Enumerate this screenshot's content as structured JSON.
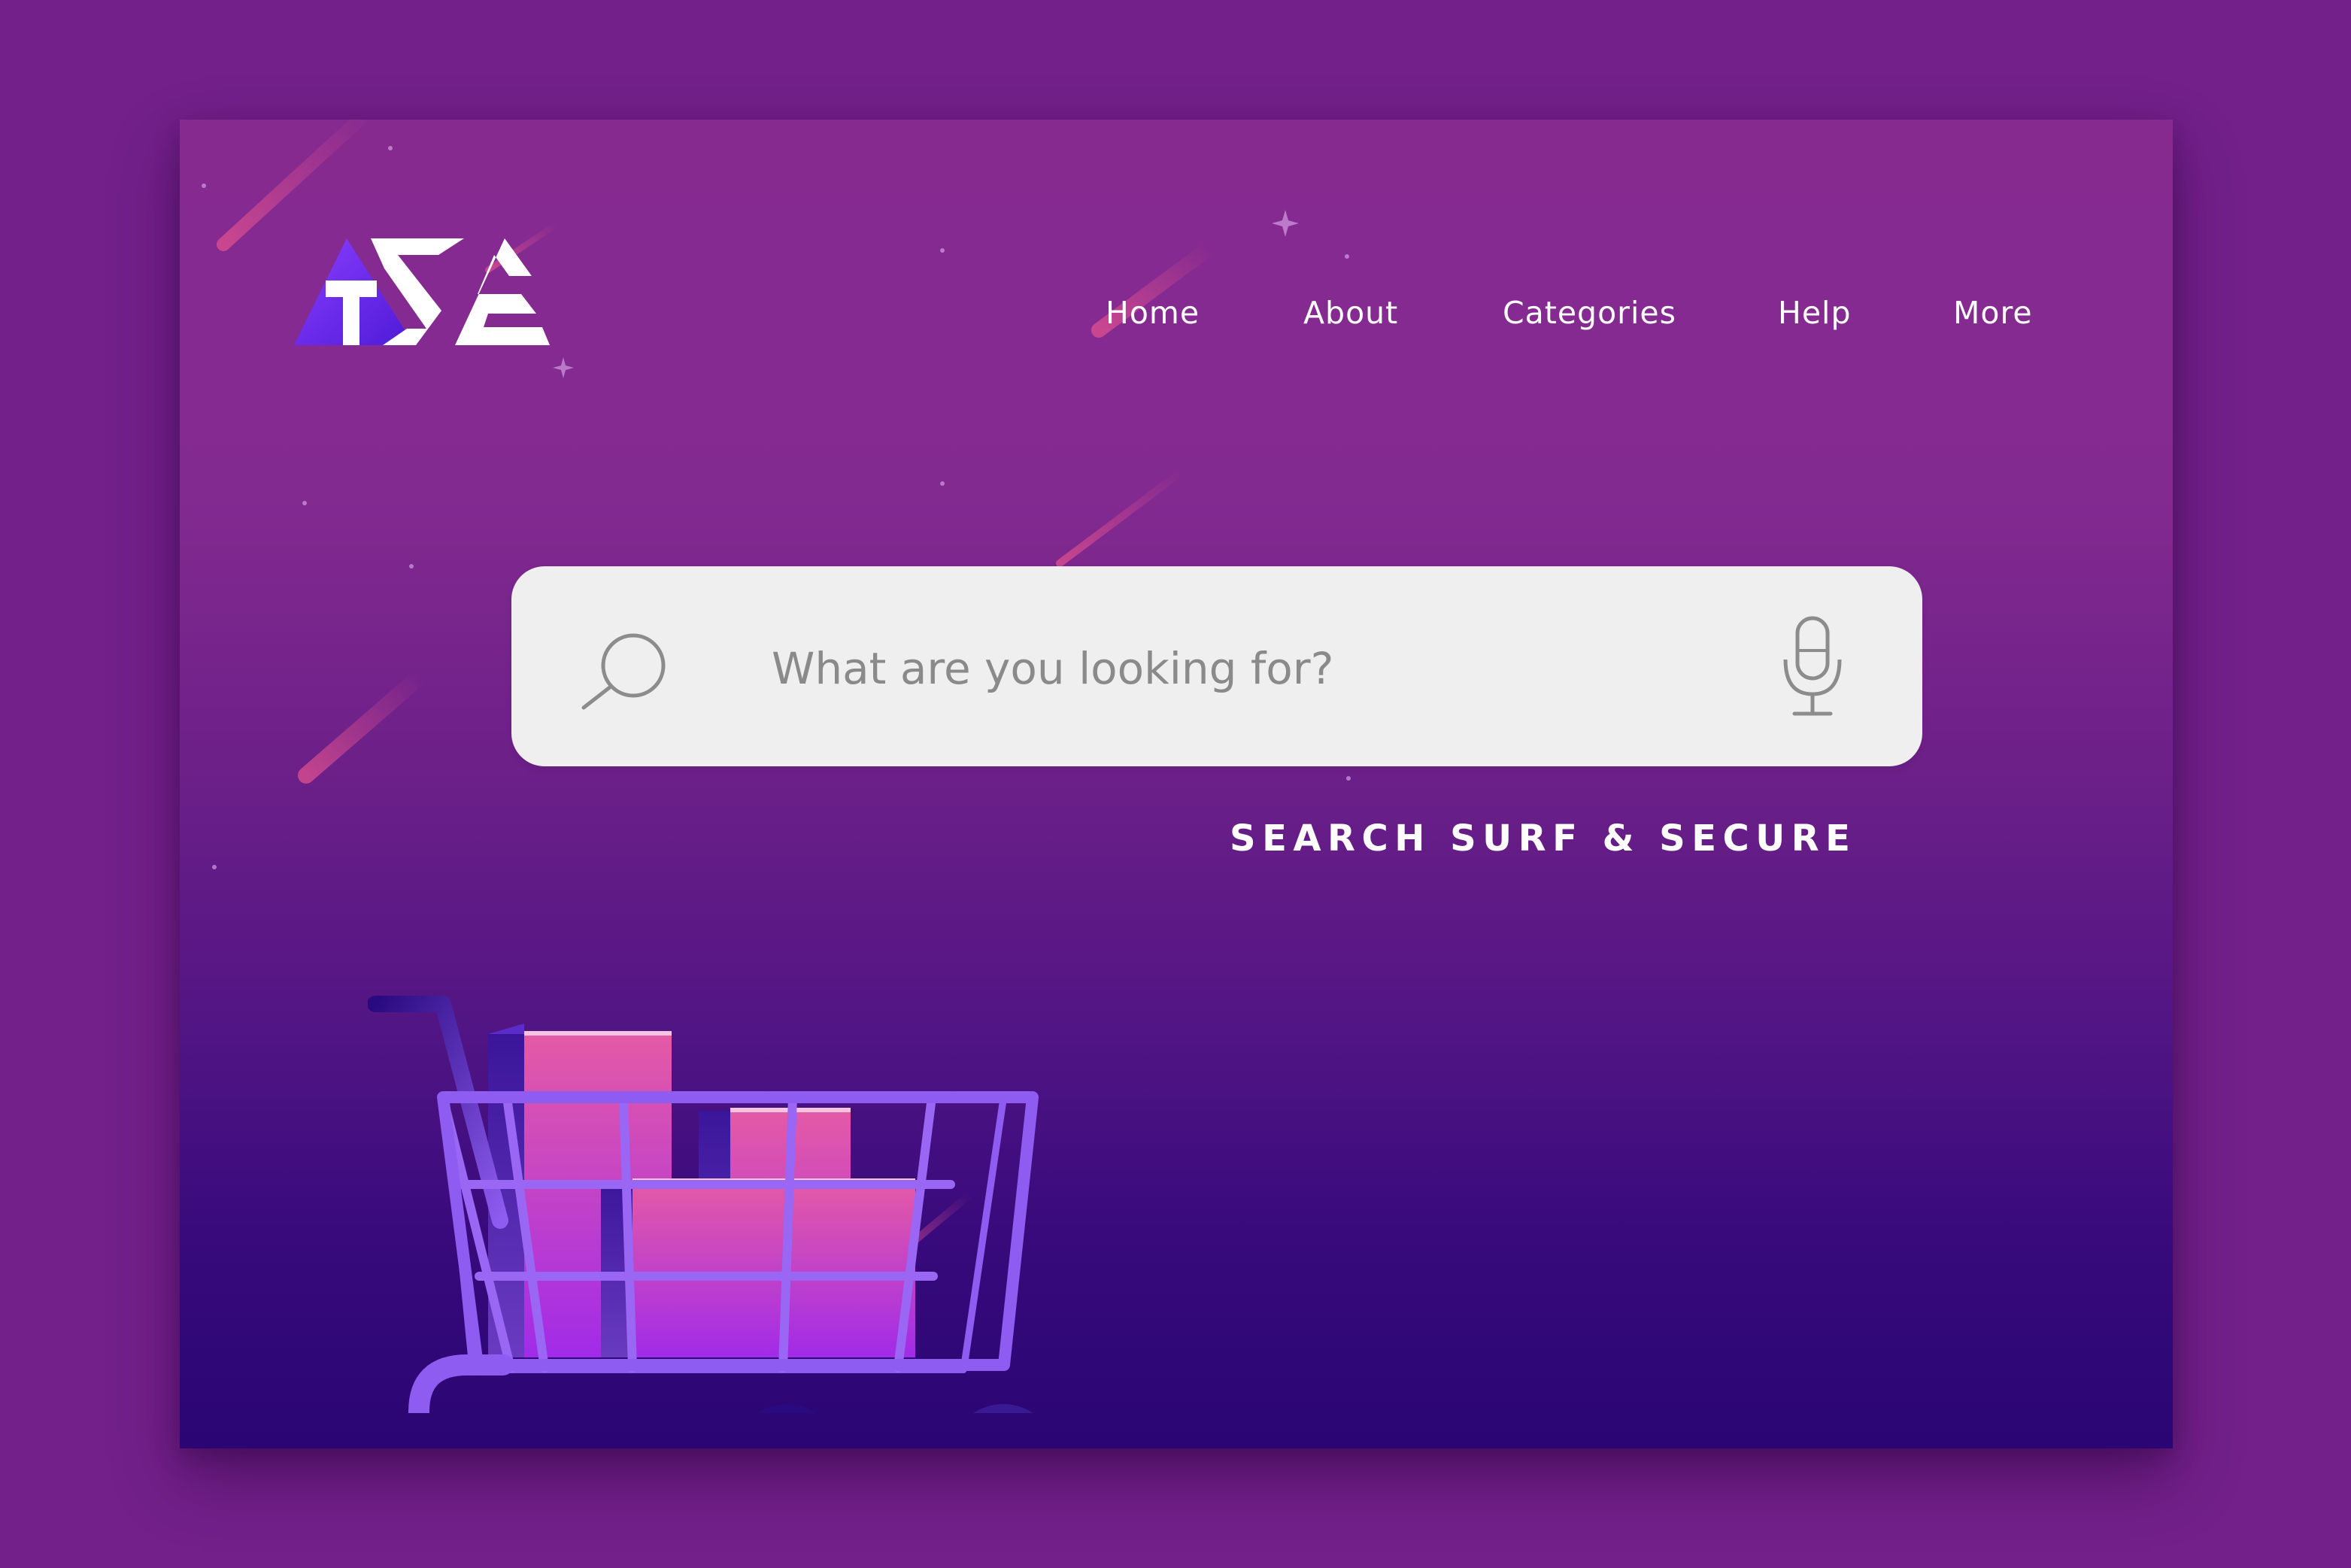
{
  "brand": {
    "logo_text": "TSE",
    "tagline": "SEARCH SURF & SECURE"
  },
  "nav": {
    "items": [
      {
        "label": "Home"
      },
      {
        "label": "About"
      },
      {
        "label": "Categories"
      },
      {
        "label": "Help"
      },
      {
        "label": "More"
      }
    ]
  },
  "search": {
    "placeholder": "What are you looking for?",
    "value": "",
    "search_icon": "search-icon",
    "mic_icon": "microphone-icon"
  },
  "illustration": {
    "name": "shopping-cart-with-boxes"
  },
  "colors": {
    "outer_background": "#73208a",
    "page_top": "#862a90",
    "page_bottom": "#2a0573",
    "search_box": "#efefef",
    "placeholder_text": "#8a8a8a",
    "nav_text": "#ffffff",
    "cart_frame": "#8e5cf0",
    "box_pink": "#e25aa8",
    "box_purple": "#a22ee6"
  }
}
